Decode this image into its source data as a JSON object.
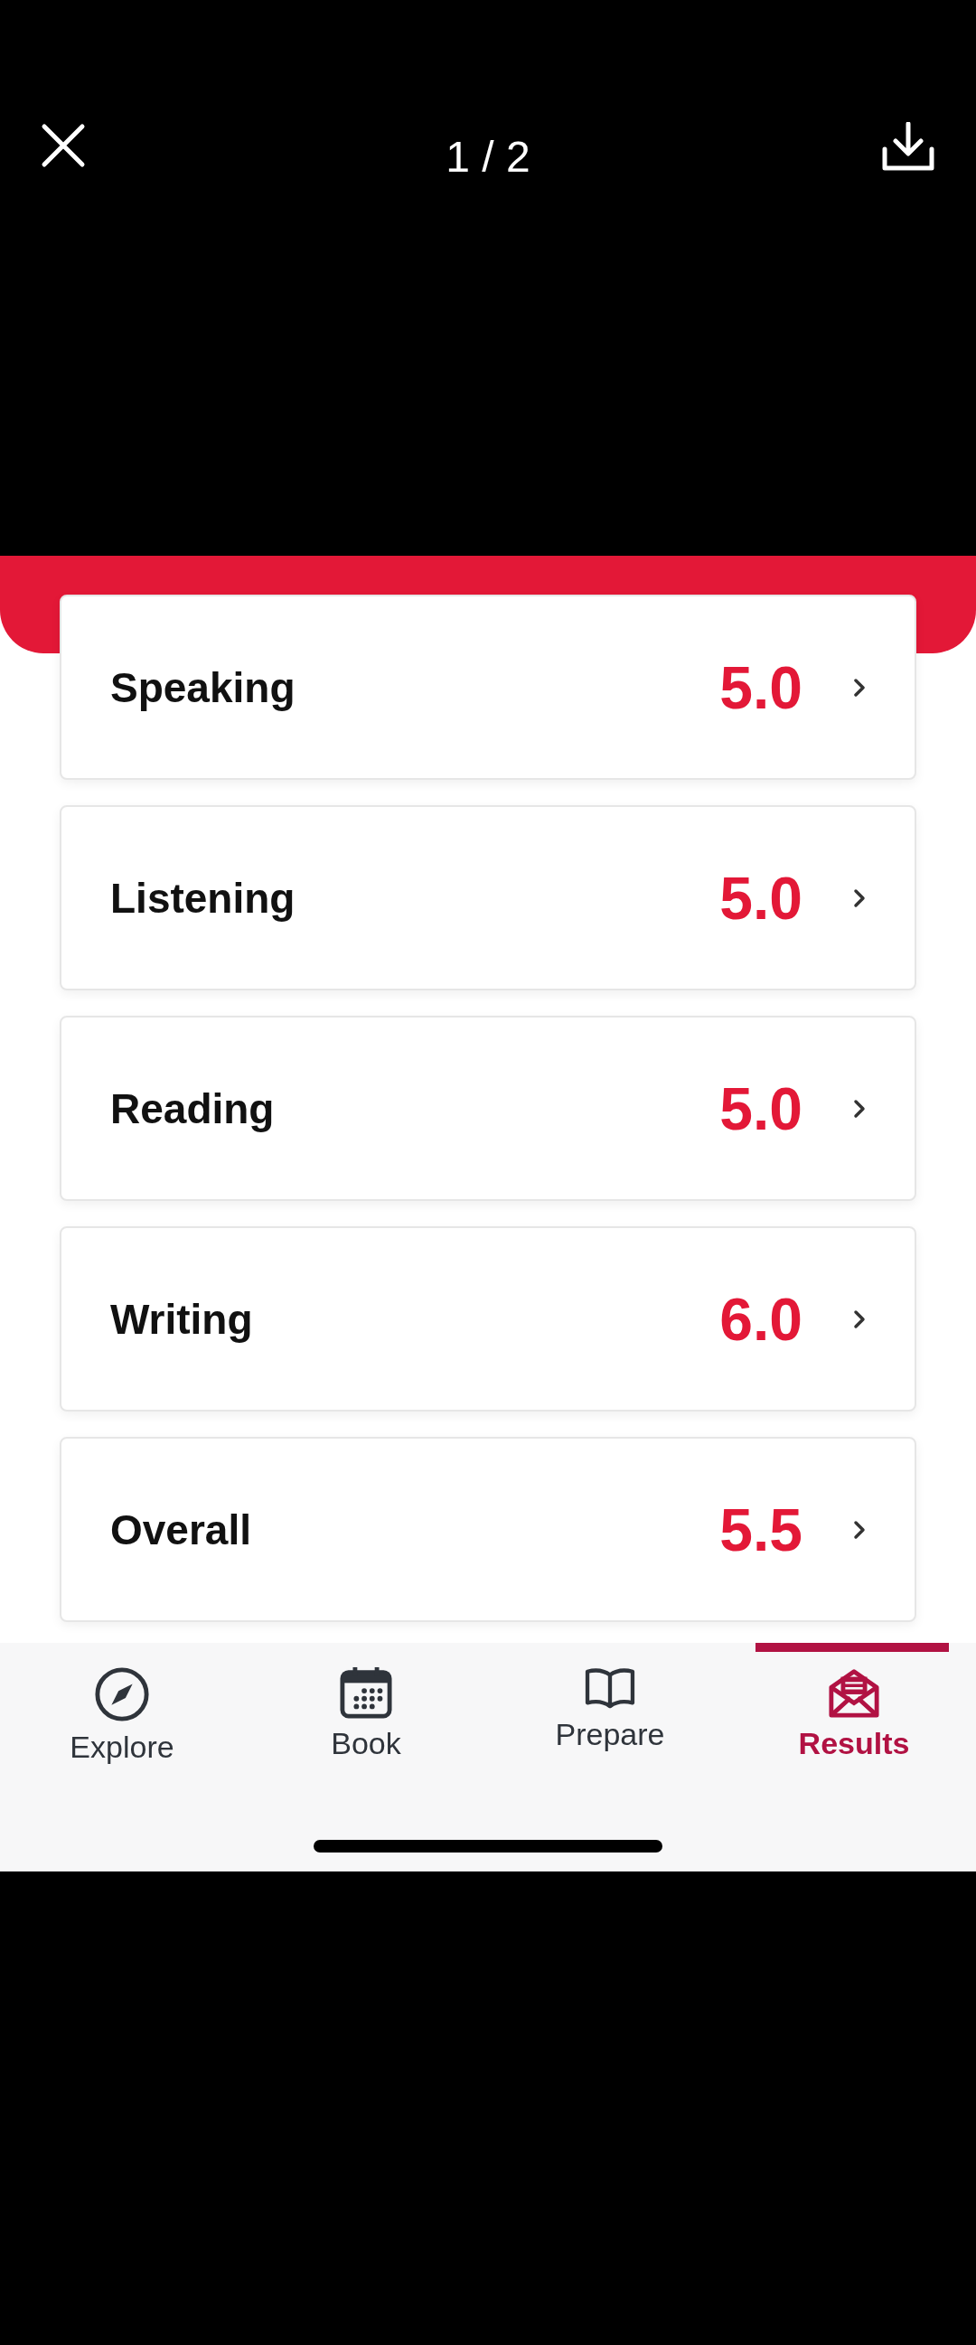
{
  "viewer": {
    "counter": "1 / 2"
  },
  "scores": [
    {
      "label": "Speaking",
      "score": "5.0"
    },
    {
      "label": "Listening",
      "score": "5.0"
    },
    {
      "label": "Reading",
      "score": "5.0"
    },
    {
      "label": "Writing",
      "score": "6.0"
    },
    {
      "label": "Overall",
      "score": "5.5"
    }
  ],
  "tab_bar": [
    {
      "label": "Explore",
      "kind": "compass",
      "selected": false
    },
    {
      "label": "Book",
      "kind": "calendar",
      "selected": false
    },
    {
      "label": "Prepare",
      "kind": "book",
      "selected": false
    },
    {
      "label": "Results",
      "kind": "envelope",
      "selected": true
    }
  ]
}
